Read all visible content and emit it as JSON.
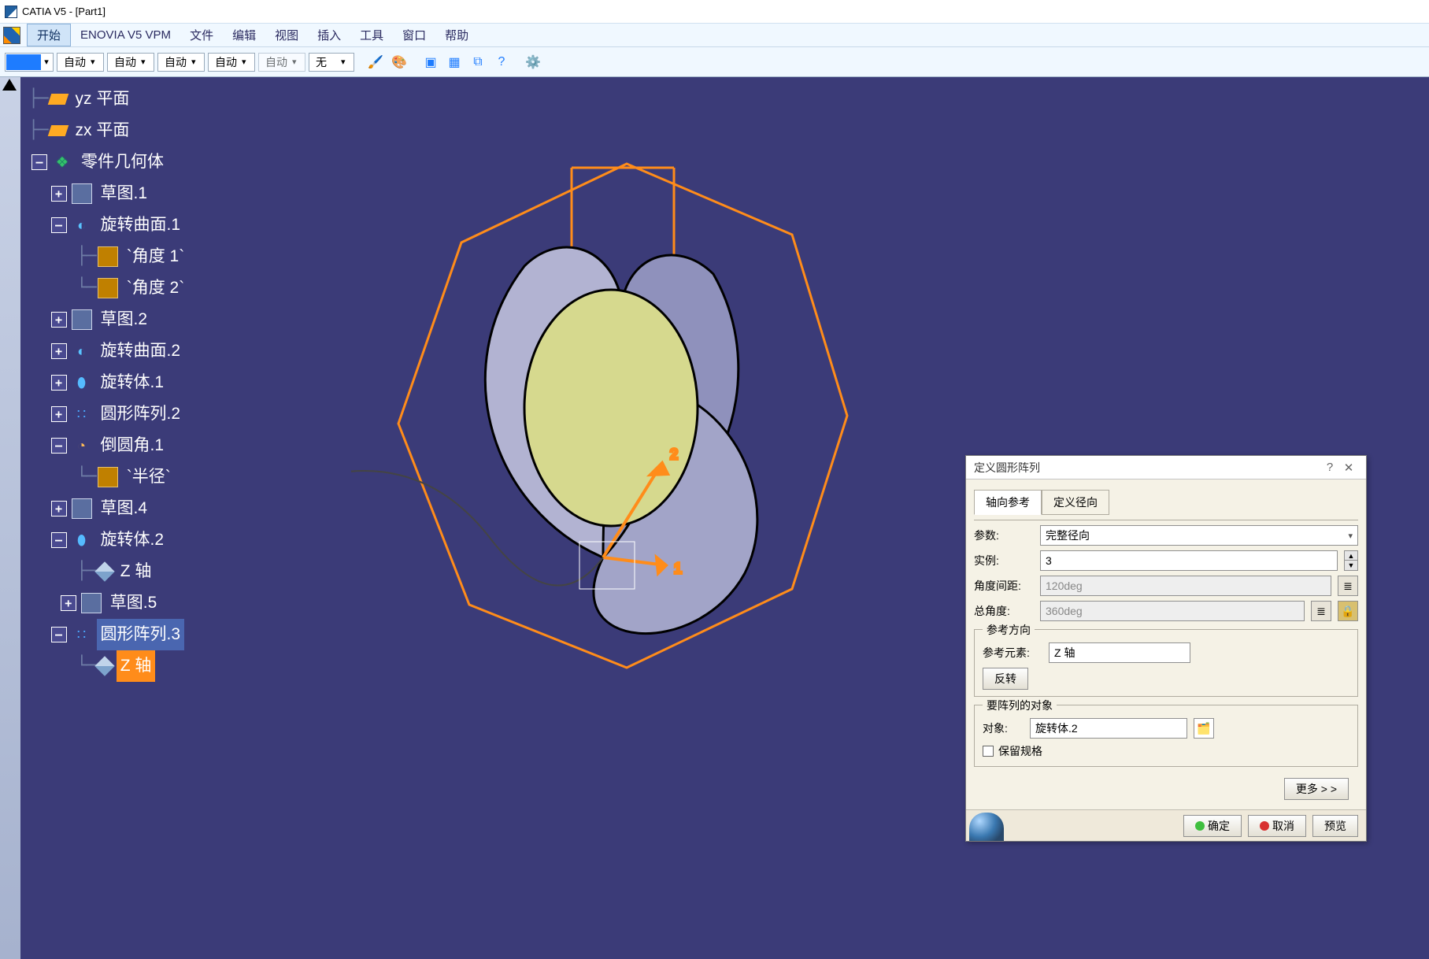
{
  "title": "CATIA V5 - [Part1]",
  "menu": {
    "start": "开始",
    "enovia": "ENOVIA V5 VPM",
    "file": "文件",
    "edit": "编辑",
    "view": "视图",
    "insert": "插入",
    "tools": "工具",
    "window": "窗口",
    "help": "帮助"
  },
  "toolbar": {
    "combo1": "自动",
    "combo2": "自动",
    "combo3": "自动",
    "combo4": "自动",
    "combo5": "自动",
    "combo6": "无"
  },
  "tree": {
    "yz": "yz 平面",
    "zx": "zx 平面",
    "body": "零件几何体",
    "sk1": "草图.1",
    "rs1": "旋转曲面.1",
    "ang1": "`角度 1`",
    "ang2": "`角度 2`",
    "sk2": "草图.2",
    "rs2": "旋转曲面.2",
    "shaft1": "旋转体.1",
    "cp2": "圆形阵列.2",
    "fil1": "倒圆角.1",
    "rad": "`半径`",
    "sk4": "草图.4",
    "shaft2": "旋转体.2",
    "zaxis": "Z 轴",
    "sk5": "草图.5",
    "cp3": "圆形阵列.3",
    "zaxis2": "Z 轴"
  },
  "dialog": {
    "title": "定义圆形阵列",
    "tab1": "轴向参考",
    "tab2": "定义径向",
    "param_lab": "参数:",
    "param_val": "完整径向",
    "inst_lab": "实例:",
    "inst_val": "3",
    "angspc_lab": "角度间距:",
    "angspc_val": "120deg",
    "totang_lab": "总角度:",
    "totang_val": "360deg",
    "refdir_group": "参考方向",
    "refel_lab": "参考元素:",
    "refel_val": "Z 轴",
    "reverse": "反转",
    "obj_group": "要阵列的对象",
    "obj_lab": "对象:",
    "obj_val": "旋转体.2",
    "keep_spec": "保留规格",
    "more": "更多 > >",
    "ok": "确定",
    "cancel": "取消",
    "preview": "预览"
  }
}
